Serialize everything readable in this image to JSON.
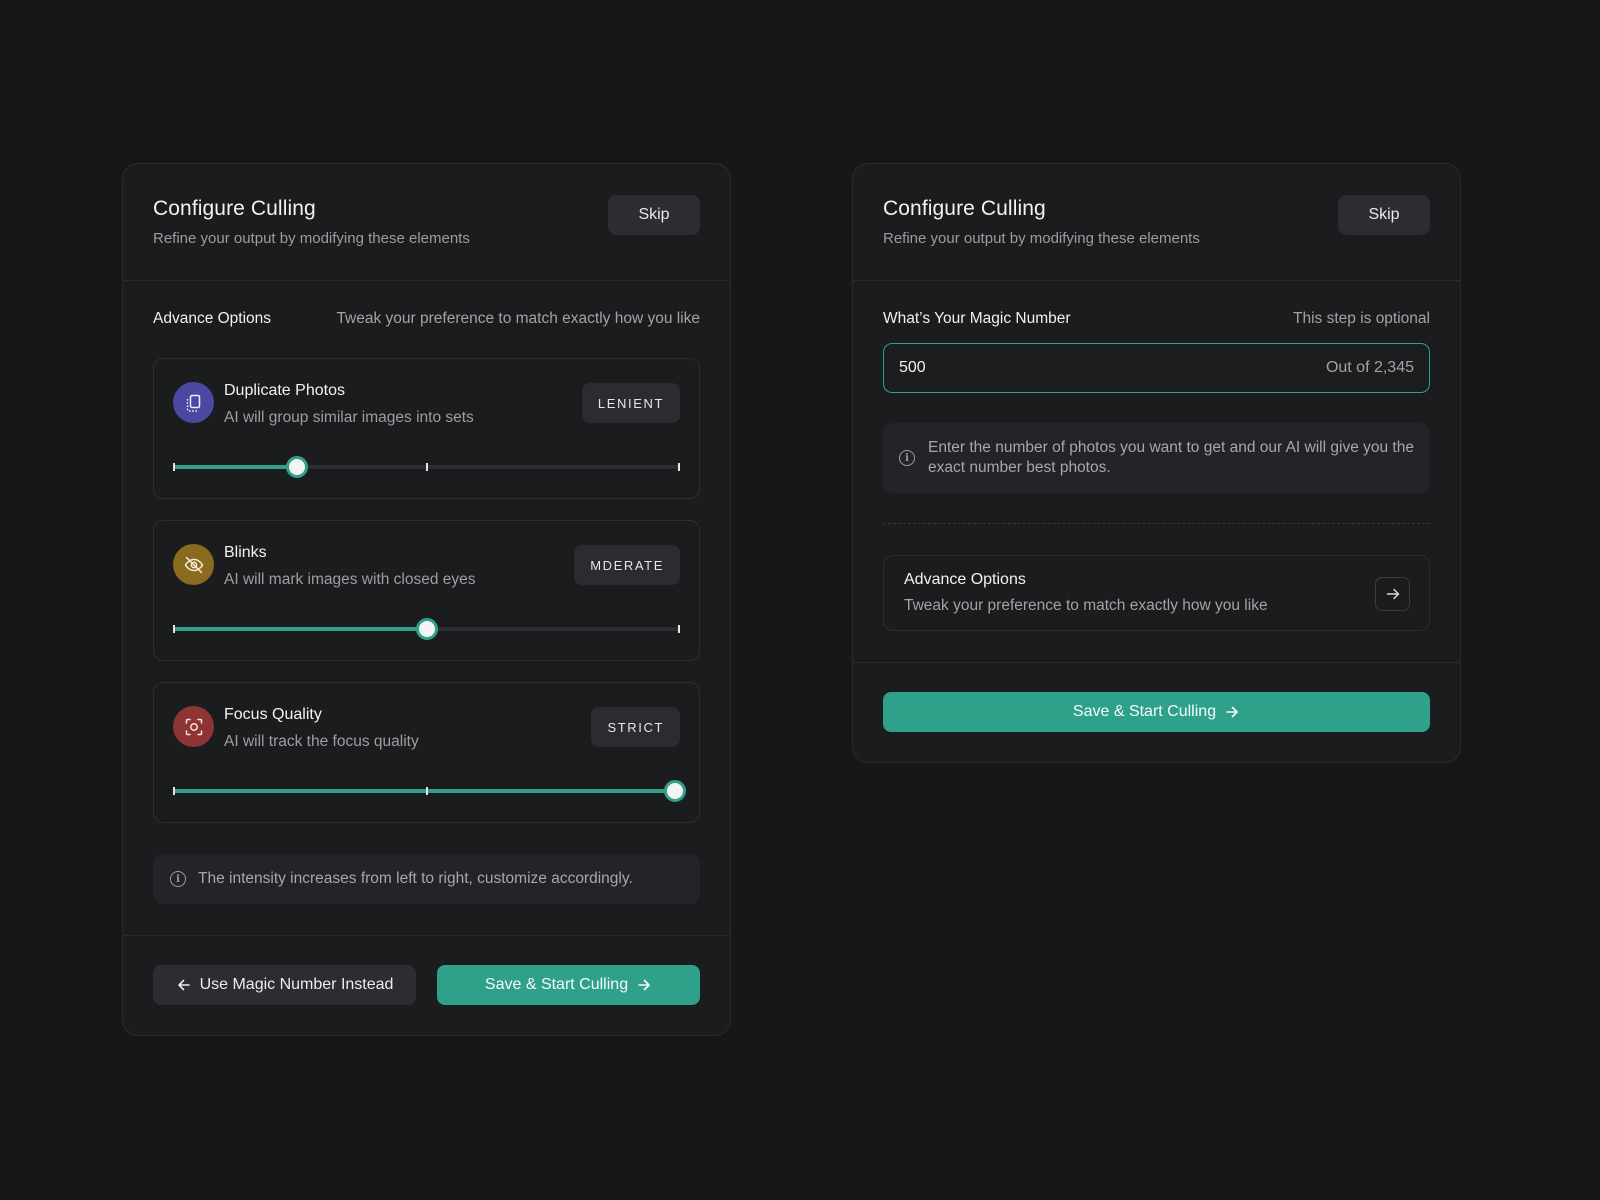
{
  "left_panel": {
    "title": "Configure Culling",
    "subtitle": "Refine your output by modifying these elements",
    "skip_label": "Skip",
    "section_label": "Advance Options",
    "section_hint": "Tweak your preference to match exactly how you like",
    "options": [
      {
        "name": "Duplicate Photos",
        "description": "AI will group similar images into sets",
        "level": "LENIENT",
        "icon": "duplicate-photos-icon",
        "icon_color": "#4a48a0",
        "value_percent": 24.5
      },
      {
        "name": "Blinks",
        "description": "AI will mark images with closed eyes",
        "level": "MDERATE",
        "icon": "eye-off-icon",
        "icon_color": "#8a6a1e",
        "value_percent": 50
      },
      {
        "name": "Focus Quality",
        "description": "AI will track the focus quality",
        "level": "STRICT",
        "icon": "focus-scan-icon",
        "icon_color": "#8f3434",
        "value_percent": 99
      }
    ],
    "info_text": "The intensity increases from left to right, customize accordingly.",
    "secondary_button": "Use Magic Number Instead",
    "primary_button": "Save & Start Culling"
  },
  "right_panel": {
    "title": "Configure Culling",
    "subtitle": "Refine your output by modifying these elements",
    "skip_label": "Skip",
    "magic_label": "What’s Your Magic Number",
    "magic_hint": "This step is optional",
    "magic_value": "500",
    "magic_out_of": "Out of 2,345",
    "info_text": "Enter the number of photos you want to get and our AI will give you the exact number best photos.",
    "advance_title": "Advance Options",
    "advance_desc": "Tweak your preference to match exactly how you like",
    "primary_button": "Save & Start Culling"
  },
  "colors": {
    "accent": "#2fa18b",
    "background": "#171718",
    "panel": "#1b1c1e"
  }
}
